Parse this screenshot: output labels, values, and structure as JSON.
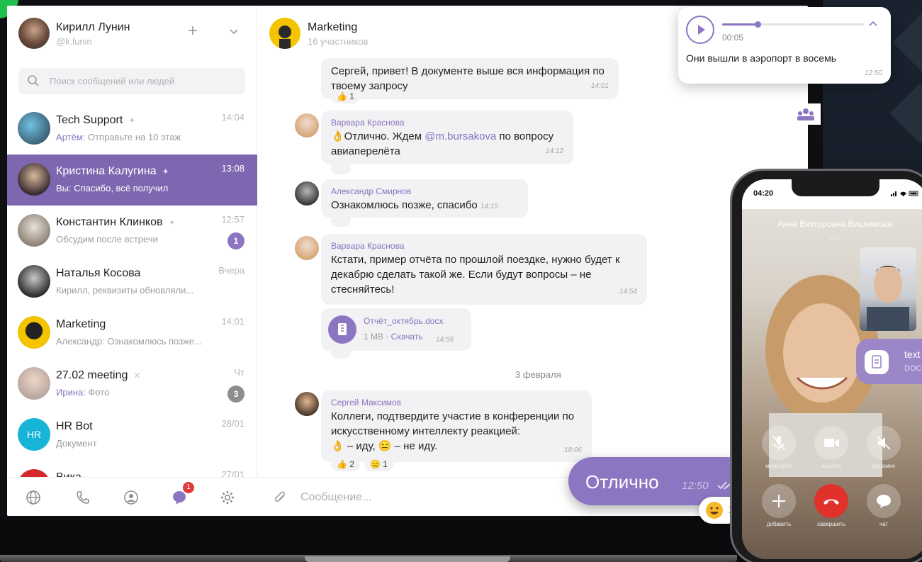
{
  "profile": {
    "name": "Кирилл Лунин",
    "handle": "@k.lunin"
  },
  "search": {
    "placeholder": "Поиск сообщений или людей"
  },
  "chats": [
    {
      "name": "Tech Support",
      "sender": "Артём:",
      "preview": " Отправьте на 10 этаж",
      "time": "14:04",
      "pinned": true,
      "badge": ""
    },
    {
      "name": "Кристина Калугина",
      "sender": "",
      "preview": "Вы: Спасибо, всё получил",
      "time": "13:08",
      "pinned": true,
      "badge": ""
    },
    {
      "name": "Константин Клинков",
      "sender": "",
      "preview": "Обсудим после встречи",
      "time": "12:57",
      "pinned": true,
      "badge": "1"
    },
    {
      "name": "Наталья Косова",
      "sender": "",
      "preview": "Кирилл, реквизиты обновляли...",
      "time": "Вчера",
      "pinned": false,
      "badge": ""
    },
    {
      "name": "Marketing",
      "sender": "",
      "preview": "Александр: Ознакомлюсь позже...",
      "time": "14:01",
      "pinned": false,
      "badge": ""
    },
    {
      "name": "27.02 meeting",
      "sender": "Ирина:",
      "preview": " Фото",
      "time": "Чт",
      "pinned": false,
      "badge": "3"
    },
    {
      "name": "HR Bot",
      "sender": "",
      "preview": "Документ",
      "time": "28/01",
      "pinned": false,
      "badge": "",
      "initials": "HR"
    },
    {
      "name": "Вика",
      "sender": "",
      "preview": "",
      "time": "27/01",
      "pinned": false,
      "badge": ""
    }
  ],
  "nav": {
    "badge": "1"
  },
  "conversation": {
    "title": "Marketing",
    "subtitle": "16 участников",
    "messages": [
      {
        "text": "Сергей, привет! В документе выше вся информация по твоему запросу",
        "time": "14:01",
        "reaction": "👍 1"
      },
      {
        "author": "Варвара Краснова",
        "text_a": "👌Отлично. Ждем ",
        "mention": "@m.bursakova",
        "text_b": " по вопросу авиаперелёта",
        "time": "14:12"
      },
      {
        "author": "Александр Смирнов",
        "text": "Ознакомлюсь позже, спасибо",
        "time": "14:15"
      },
      {
        "author": "Варвара Краснова",
        "text": "Кстати, пример отчёта по прошлой поездке, нужно будет к декабрю сделать такой же. Если будут вопросы – не стесняйтесь!",
        "time": "14:54"
      },
      {
        "file_name": "Отчёт_октябрь.docx",
        "file_meta_a": "1 MB · ",
        "file_meta_link": "Скачать",
        "time": "14:55"
      },
      {
        "author": "Сергей Максимов",
        "text": "Коллеги, подтвердите участие в конференции по искусственному интеллекту реакцией:",
        "text2": "👌 – иду, 😑 – не иду.",
        "time": "18:06",
        "reaction_a": "👍 2",
        "reaction_b": "😑 1"
      }
    ],
    "date_separator": "3 февраля",
    "composer_placeholder": "Сообщение..."
  },
  "voice_message": {
    "duration": "00:05",
    "text": "Они вышли в аэропорт в восемь",
    "time": "12:50",
    "progress": 0.25
  },
  "big_message": {
    "text": "Отлично",
    "time": "12:50",
    "reaction_count": "1"
  },
  "phone": {
    "time": "04:20",
    "caller": "Анна Викторовна Вишнякова",
    "duration": "0:05",
    "buttons": [
      "микрофон",
      "камера",
      "динамик",
      "добавить",
      "завершить",
      "чат"
    ]
  },
  "file_chip": {
    "name": "text",
    "type": "DOC"
  },
  "colors": {
    "accent": "#8d76c1",
    "active_chat": "#7f66b0",
    "end_call": "#e0312b"
  }
}
